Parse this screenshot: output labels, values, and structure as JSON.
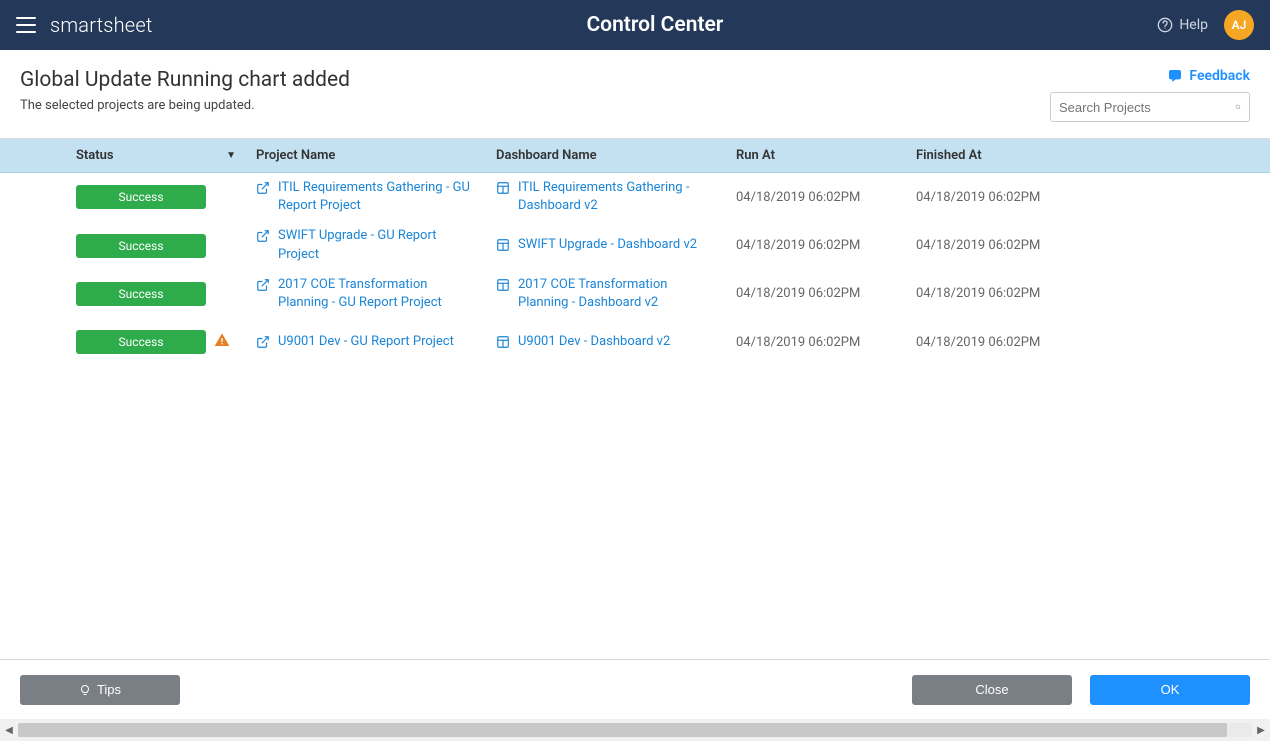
{
  "navbar": {
    "brand": "smartsheet",
    "title": "Control Center",
    "help_label": "Help",
    "avatar_initials": "AJ"
  },
  "subheader": {
    "title": "Global Update Running chart added",
    "subtitle": "The selected projects are being updated.",
    "feedback_label": "Feedback"
  },
  "search": {
    "placeholder": "Search Projects"
  },
  "columns": {
    "status": "Status",
    "project": "Project Name",
    "dashboard": "Dashboard Name",
    "run_at": "Run At",
    "finished_at": "Finished At"
  },
  "rows": [
    {
      "status": "Success",
      "warning": false,
      "project": "ITIL Requirements Gathering - GU Report Project",
      "dashboard": "ITIL Requirements Gathering - Dashboard v2",
      "run_at": "04/18/2019 06:02PM",
      "finished_at": "04/18/2019 06:02PM"
    },
    {
      "status": "Success",
      "warning": false,
      "project": "SWIFT Upgrade - GU Report Project",
      "dashboard": "SWIFT Upgrade - Dashboard v2",
      "run_at": "04/18/2019 06:02PM",
      "finished_at": "04/18/2019 06:02PM"
    },
    {
      "status": "Success",
      "warning": false,
      "project": "2017 COE Transformation Planning - GU Report Project",
      "dashboard": "2017 COE Transformation Planning - Dashboard v2",
      "run_at": "04/18/2019 06:02PM",
      "finished_at": "04/18/2019 06:02PM"
    },
    {
      "status": "Success",
      "warning": true,
      "project": "U9001 Dev - GU Report Project",
      "dashboard": "U9001 Dev - Dashboard v2",
      "run_at": "04/18/2019 06:02PM",
      "finished_at": "04/18/2019 06:02PM"
    }
  ],
  "footer": {
    "tips_label": "Tips",
    "close_label": "Close",
    "ok_label": "OK"
  }
}
